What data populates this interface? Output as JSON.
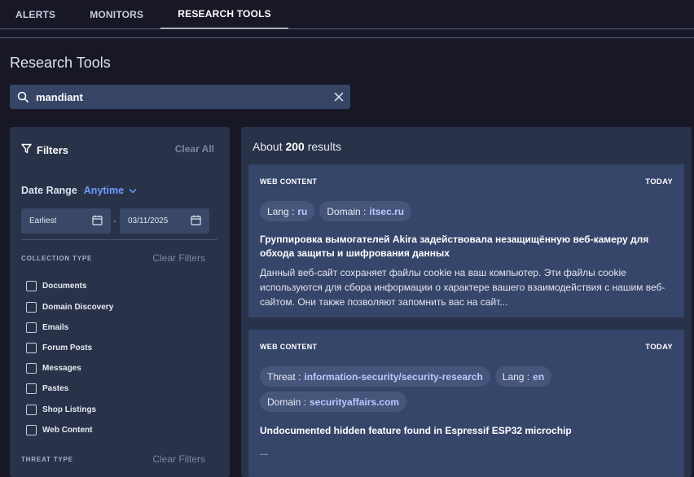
{
  "nav": {
    "tabs": [
      {
        "label": "ALERTS"
      },
      {
        "label": "MONITORS"
      },
      {
        "label": "RESEARCH TOOLS"
      }
    ],
    "active_index": 2
  },
  "page": {
    "title": "Research Tools"
  },
  "search": {
    "value": "mandiant",
    "placeholder": ""
  },
  "filters": {
    "title": "Filters",
    "clear_all": "Clear All",
    "date_range": {
      "label": "Date Range",
      "value": "Anytime",
      "from": "Earliest",
      "dash": "-",
      "to": "03/11/2025"
    },
    "collection_type": {
      "label": "COLLECTION TYPE",
      "clear": "Clear Filters",
      "options": [
        "Documents",
        "Domain Discovery",
        "Emails",
        "Forum Posts",
        "Messages",
        "Pastes",
        "Shop Listings",
        "Web Content"
      ]
    },
    "threat_type": {
      "label": "THREAT TYPE",
      "clear": "Clear Filters"
    }
  },
  "results": {
    "prefix": "About ",
    "count": "200",
    "suffix": " results",
    "items": [
      {
        "type": "WEB CONTENT",
        "date": "TODAY",
        "chips": [
          {
            "key": "Lang :",
            "value": "ru"
          },
          {
            "key": "Domain :",
            "value": "itsec.ru"
          }
        ],
        "title": "Группировка вымогателей Akira задействовала незащищённую веб-камеру для обхода защиты и шифрования данных",
        "snippet": "Данный веб-сайт сохраняет файлы cookie на ваш компьютер. Эти файлы cookie используются для сбора информации о характере вашего взаимодействия с нашим веб-сайтом. Они также позволяют запомнить вас на сайт..."
      },
      {
        "type": "WEB CONTENT",
        "date": "TODAY",
        "chips": [
          {
            "key": "Threat :",
            "value": "information-security/security-research"
          },
          {
            "key": "Lang :",
            "value": "en"
          },
          {
            "key": "Domain :",
            "value": "securityaffairs.com"
          }
        ],
        "title": "Undocumented hidden feature found in Espressif ESP32 microchip",
        "snippet": "..."
      }
    ]
  },
  "colors": {
    "accent": "#6f9cff",
    "background": "#171726",
    "panel": "#283249",
    "card": "#36456a"
  }
}
